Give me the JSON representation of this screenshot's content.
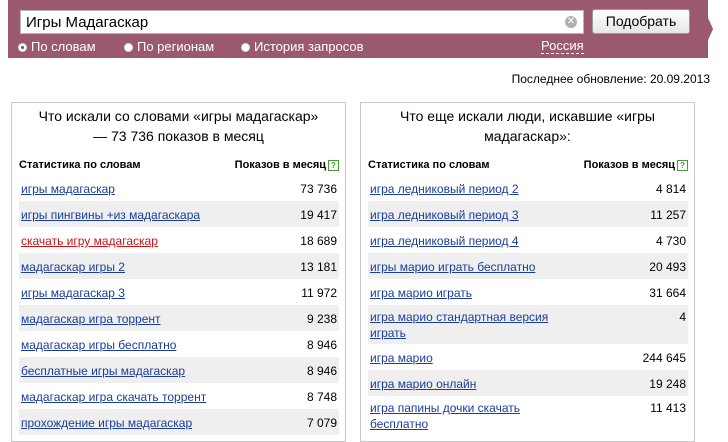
{
  "search": {
    "query": "Игры Мадагаскар",
    "button": "Подобрать"
  },
  "modes": [
    {
      "label": "По словам",
      "selected": true
    },
    {
      "label": "По регионам",
      "selected": false
    },
    {
      "label": "История запросов",
      "selected": false
    }
  ],
  "region": "Россия",
  "updated": "Последнее обновление: 20.09.2013",
  "colors": {
    "header": "#9b596f",
    "link": "#1a3d9c",
    "visited": "#cc1111",
    "row_alt": "#efefef"
  },
  "left": {
    "title": "Что искали со словами «игры мадагаскар» — 73 736 показов в месяц",
    "col_words": "Статистика по словам",
    "col_count": "Показов в месяц",
    "rows": [
      {
        "phrase": "игры мадагаскар",
        "count": "73 736"
      },
      {
        "phrase": "игры пингвины +из мадагаскара",
        "count": "19 417"
      },
      {
        "phrase": "скачать игру мадагаскар",
        "count": "18 689"
      },
      {
        "phrase": "мадагаскар игры 2",
        "count": "13 181"
      },
      {
        "phrase": "игры мадагаскар 3",
        "count": "11 972"
      },
      {
        "phrase": "мадагаскар игра торрент",
        "count": "9 238"
      },
      {
        "phrase": "мадагаскар игры бесплатно",
        "count": "8 946"
      },
      {
        "phrase": "бесплатные игры мадагаскар",
        "count": "8 946"
      },
      {
        "phrase": "мадагаскар игра скачать торрент",
        "count": "8 748"
      },
      {
        "phrase": "прохождение игры мадагаскар",
        "count": "7 079"
      }
    ]
  },
  "right": {
    "title": "Что еще искали люди, искавшие «игры мадагаскар»:",
    "col_words": "Статистика по словам",
    "col_count": "Показов в месяц",
    "rows": [
      {
        "phrase": "игра ледниковый период 2",
        "count": "4 814"
      },
      {
        "phrase": "игра ледниковый период 3",
        "count": "11 257"
      },
      {
        "phrase": "игра ледниковый период 4",
        "count": "4 730"
      },
      {
        "phrase": "игры марио играть бесплатно",
        "count": "20 493"
      },
      {
        "phrase": "игра марио играть",
        "count": "31 664"
      },
      {
        "phrase": "игра марио стандартная версия играть",
        "count": "4"
      },
      {
        "phrase": "игра марио",
        "count": "244 645"
      },
      {
        "phrase": "игра марио онлайн",
        "count": "19 248"
      },
      {
        "phrase": "игра папины дочки скачать бесплатно",
        "count": "11 413"
      }
    ]
  }
}
